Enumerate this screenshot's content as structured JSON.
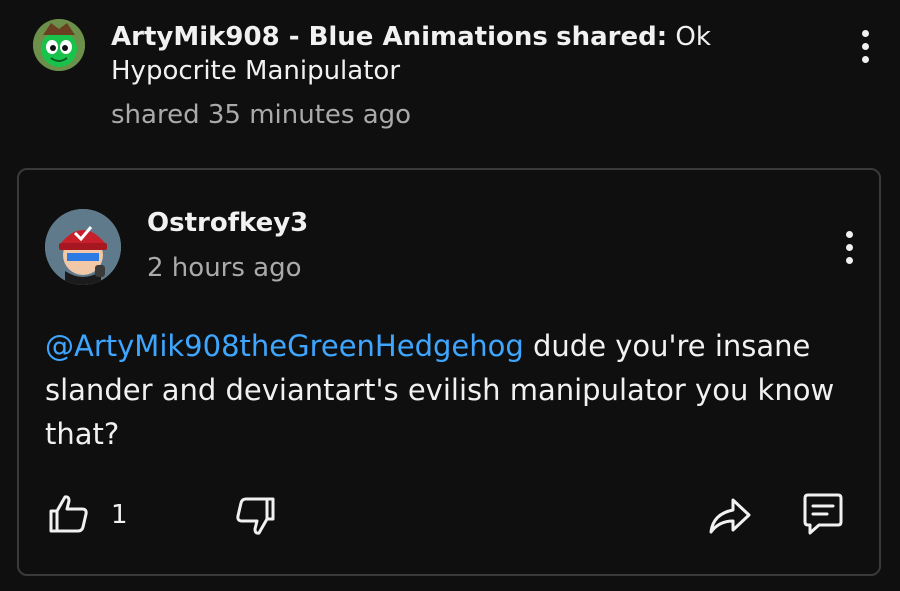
{
  "post": {
    "author": "ArtyMik908 - Blue Animations",
    "action": "shared:",
    "title": "Ok Hypocrite Manipulator",
    "meta": "shared 35 minutes ago"
  },
  "comment": {
    "author": "Ostrofkey3",
    "time": "2 hours ago",
    "mention": "@ArtyMik908theGreenHedgehog",
    "text": "dude you're insane slander and deviantart's evilish manipulator you know that?",
    "likes": "1"
  },
  "icons": {
    "post_menu": "more-vert-icon",
    "comment_menu": "more-vert-icon",
    "like": "thumb-up-icon",
    "dislike": "thumb-down-icon",
    "share": "share-icon",
    "reply": "comment-icon"
  },
  "colors": {
    "background": "#0f0f0f",
    "text": "#f1f1f1",
    "secondary_text": "#aaaaaa",
    "mention": "#3ea6ff",
    "card_border": "#3a3a3a"
  }
}
